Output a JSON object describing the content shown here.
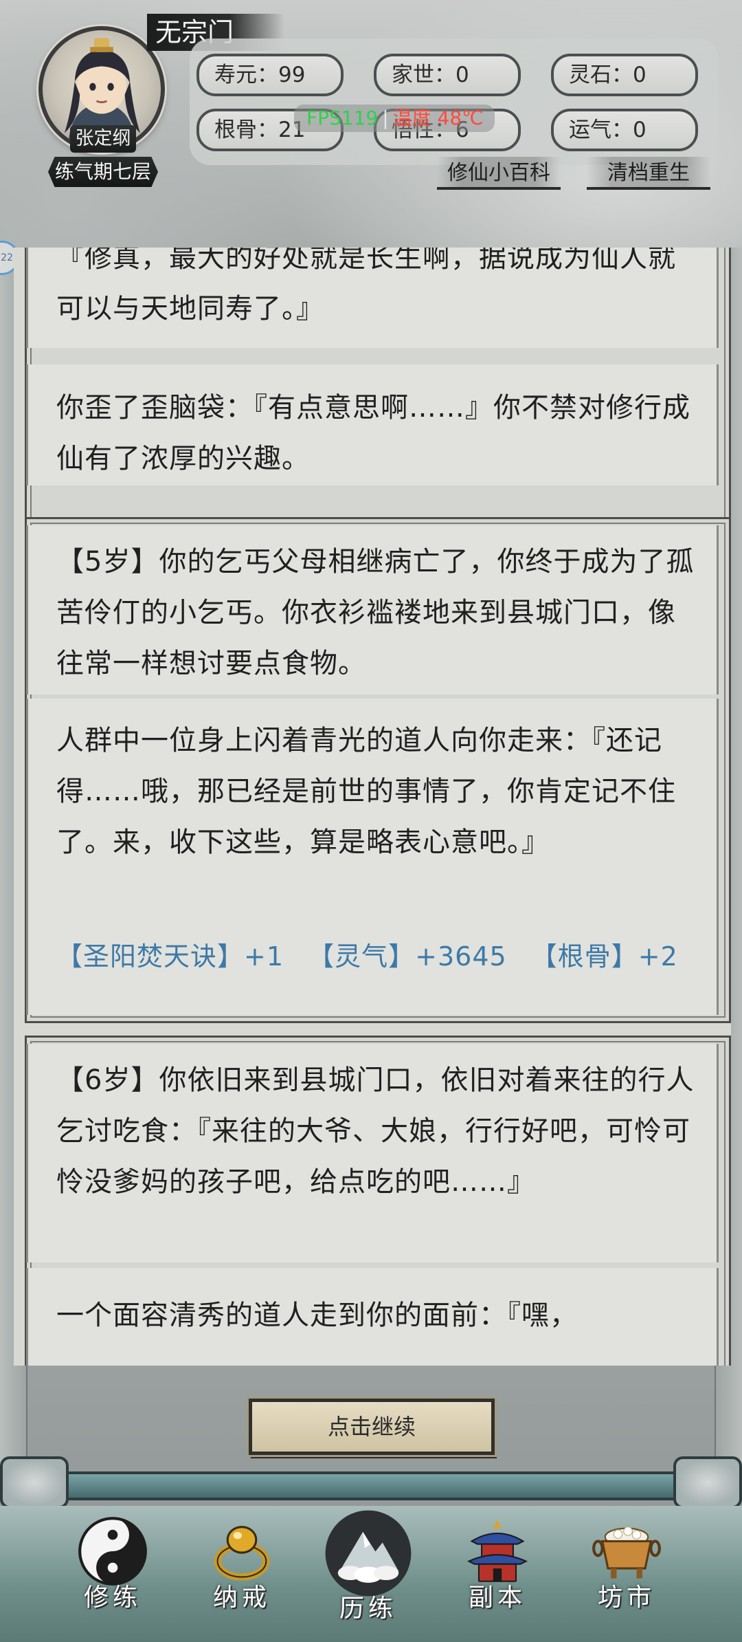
{
  "header": {
    "sect": "无宗门",
    "character_name": "张定纲",
    "realm": "练气期七层",
    "stats": [
      {
        "text": "寿元：99"
      },
      {
        "text": "家世：0"
      },
      {
        "text": "灵石：0"
      },
      {
        "text": "根骨：21"
      },
      {
        "text": "悟性：6"
      },
      {
        "text": "运气：0"
      }
    ],
    "fps": "FPS119",
    "fps_sep": "|",
    "temperature": "温度 48℃",
    "links": {
      "wiki": "修仙小百科",
      "reset": "清档重生"
    },
    "side_badge": "22"
  },
  "story": {
    "entries": [
      {
        "paragraphs": [
          "『修真，最大的好处就是长生啊，据说成为仙人就可以与天地同寿了。』",
          "你歪了歪脑袋：『有点意思啊……』你不禁对修行成仙有了浓厚的兴趣。"
        ]
      },
      {
        "paragraphs": [
          "【5岁】你的乞丐父母相继病亡了，你终于成为了孤苦伶仃的小乞丐。你衣衫褴褛地来到县城门口，像往常一样想讨要点食物。",
          "人群中一位身上闪着青光的道人向你走来：『还记得……哦，那已经是前世的事情了，你肯定记不住了。来，收下这些，算是略表心意吧。』"
        ],
        "rewards": [
          "【圣阳焚天诀】+1",
          "【灵气】+3645",
          "【根骨】+2"
        ]
      },
      {
        "paragraphs": [
          "【6岁】你依旧来到县城门口，依旧对着来往的行人乞讨吃食：『来往的大爷、大娘，行行好吧，可怜可怜没爹妈的孩子吧，给点吃的吧……』",
          "一个面容清秀的道人走到你的面前：『嘿，"
        ]
      }
    ],
    "continue_label": "点击继续"
  },
  "nav": {
    "items": [
      {
        "label": "修练",
        "icon": "yin-yang-icon"
      },
      {
        "label": "纳戒",
        "icon": "ring-icon"
      },
      {
        "label": "历练",
        "icon": "mountain-cloud-icon",
        "active": true
      },
      {
        "label": "副本",
        "icon": "pagoda-icon"
      },
      {
        "label": "坊市",
        "icon": "treasure-cauldron-icon"
      }
    ]
  },
  "colors": {
    "reward_text": "#3d79a8",
    "fps_green": "#2fd24a",
    "temp_red": "#ff4a3d"
  }
}
